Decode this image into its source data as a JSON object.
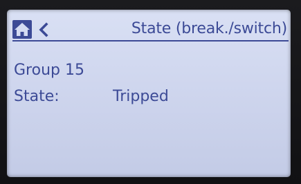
{
  "header": {
    "title": "State (break./switch)",
    "home_icon": "home-icon",
    "back_icon": "chevron-left-icon"
  },
  "content": {
    "group_label": "Group 15",
    "state_label": "State:",
    "state_value": "Tripped"
  },
  "colors": {
    "text": "#3c4a96",
    "screen_background": "#d4dbf2",
    "bezel": "#141416"
  }
}
